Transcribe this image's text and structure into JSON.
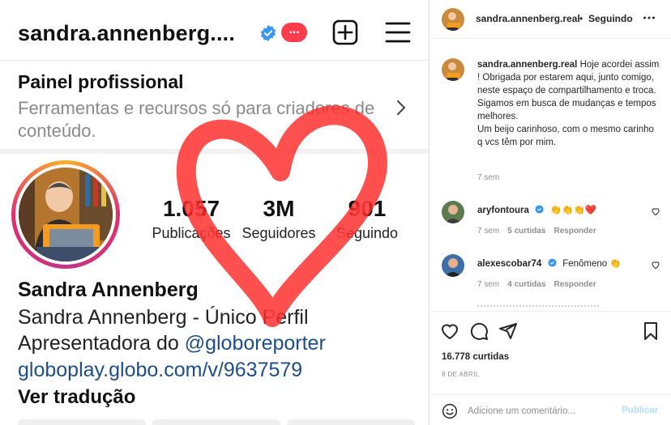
{
  "post_image": {
    "username": "sandra.annenberg....",
    "notification_badge": "...",
    "panel": {
      "title": "Painel profissional",
      "description": "Ferramentas e recursos só para criadores de conteúdo."
    },
    "stats": [
      {
        "number": "1.057",
        "label": "Publicações"
      },
      {
        "number": "3M",
        "label": "Seguidores"
      },
      {
        "number": "901",
        "label": "Seguindo"
      }
    ],
    "display_name": "Sandra Annenberg",
    "bio_line1": "Sandra Annenberg - Único Perfil",
    "bio_line2_prefix": "Apresentadora do ",
    "bio_line2_mention": "@globoreporter",
    "link": "globoplay.globo.com/v/9637579",
    "translate": "Ver tradução",
    "heart_color": "#ff2a2a"
  },
  "header": {
    "username": "sandra.annenberg.real",
    "separator": "•",
    "follow_status": "Seguindo"
  },
  "caption": {
    "username": "sandra.annenberg.real",
    "text": "Hoje acordei assim ! Obrigada por estarem aqui, junto comigo, neste espaço de compartilhamento e troca.\nSigamos em busca de mudanças e tempos melhores.\nUm beijo carinhoso, com o mesmo carinho q vcs têm por mim.",
    "time": "7 sem"
  },
  "comments": [
    {
      "username": "aryfontoura",
      "verified": true,
      "text": "👏👏👏❤️",
      "time": "7 sem",
      "likes": "5 curtidas",
      "reply": "Responder"
    },
    {
      "username": "alexescobar74",
      "verified": true,
      "text": "Fenômeno 👏",
      "time": "7 sem",
      "likes": "4 curtidas",
      "reply": "Responder"
    }
  ],
  "likes": "16.778 curtidas",
  "date": "8 DE ABRIL",
  "add_comment": {
    "placeholder": "Adicione um comentário...",
    "publish": "Publicar"
  },
  "colors": {
    "verified": "#3897f0",
    "link": "#1d4e89",
    "publish_disabled": "#b2dffc"
  },
  "icons": [
    "verified-icon",
    "new-post-icon",
    "menu-icon",
    "chevron-right-icon",
    "more-icon",
    "heart-icon",
    "comment-icon",
    "share-icon",
    "bookmark-icon",
    "emoji-icon"
  ]
}
